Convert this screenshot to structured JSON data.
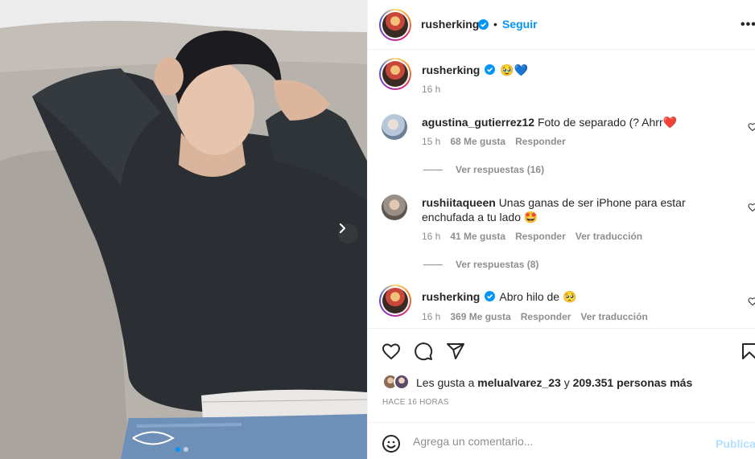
{
  "post": {
    "author": "rusherking",
    "follow_label": "Seguir",
    "separator": "•",
    "more_label": "•••"
  },
  "caption": {
    "author": "rusherking",
    "text": "🥹💙",
    "time": "16 h"
  },
  "comments": [
    {
      "author": "agustina_gutierrez12",
      "text": "Foto de separado (? Ahrr❤️",
      "time": "15 h",
      "likes": "68 Me gusta",
      "reply_label": "Responder",
      "view_replies": "Ver respuestas (16)"
    },
    {
      "author": "rushiitaqueen",
      "text": "Unas ganas de ser iPhone para estar enchufada a tu lado 🤩",
      "time": "16 h",
      "likes": "41 Me gusta",
      "reply_label": "Responder",
      "translate_label": "Ver traducción",
      "view_replies": "Ver respuestas (8)"
    },
    {
      "author": "rusherking",
      "text": "Abro hilo de 🥺",
      "time": "16 h",
      "likes": "369 Me gusta",
      "reply_label": "Responder",
      "translate_label": "Ver traducción"
    }
  ],
  "likes_line": {
    "prefix": "Les gusta a",
    "user": "melualvarez_23",
    "middle": "y",
    "count": "209.351 personas más"
  },
  "time_ago": "HACE 16 HORAS",
  "composer": {
    "placeholder": "Agrega un comentario...",
    "publish_label": "Publicar"
  },
  "carousel": {
    "current": 1,
    "total": 2
  },
  "colors": {
    "accent": "#0095f6",
    "verified": "#0095f6",
    "muted": "#8e8e8e",
    "publish_disabled": "#b2dffc"
  },
  "icons": [
    "verified-icon",
    "heart-icon",
    "comment-icon",
    "share-icon",
    "bookmark-icon",
    "emoji-icon",
    "chevron-right-icon"
  ]
}
